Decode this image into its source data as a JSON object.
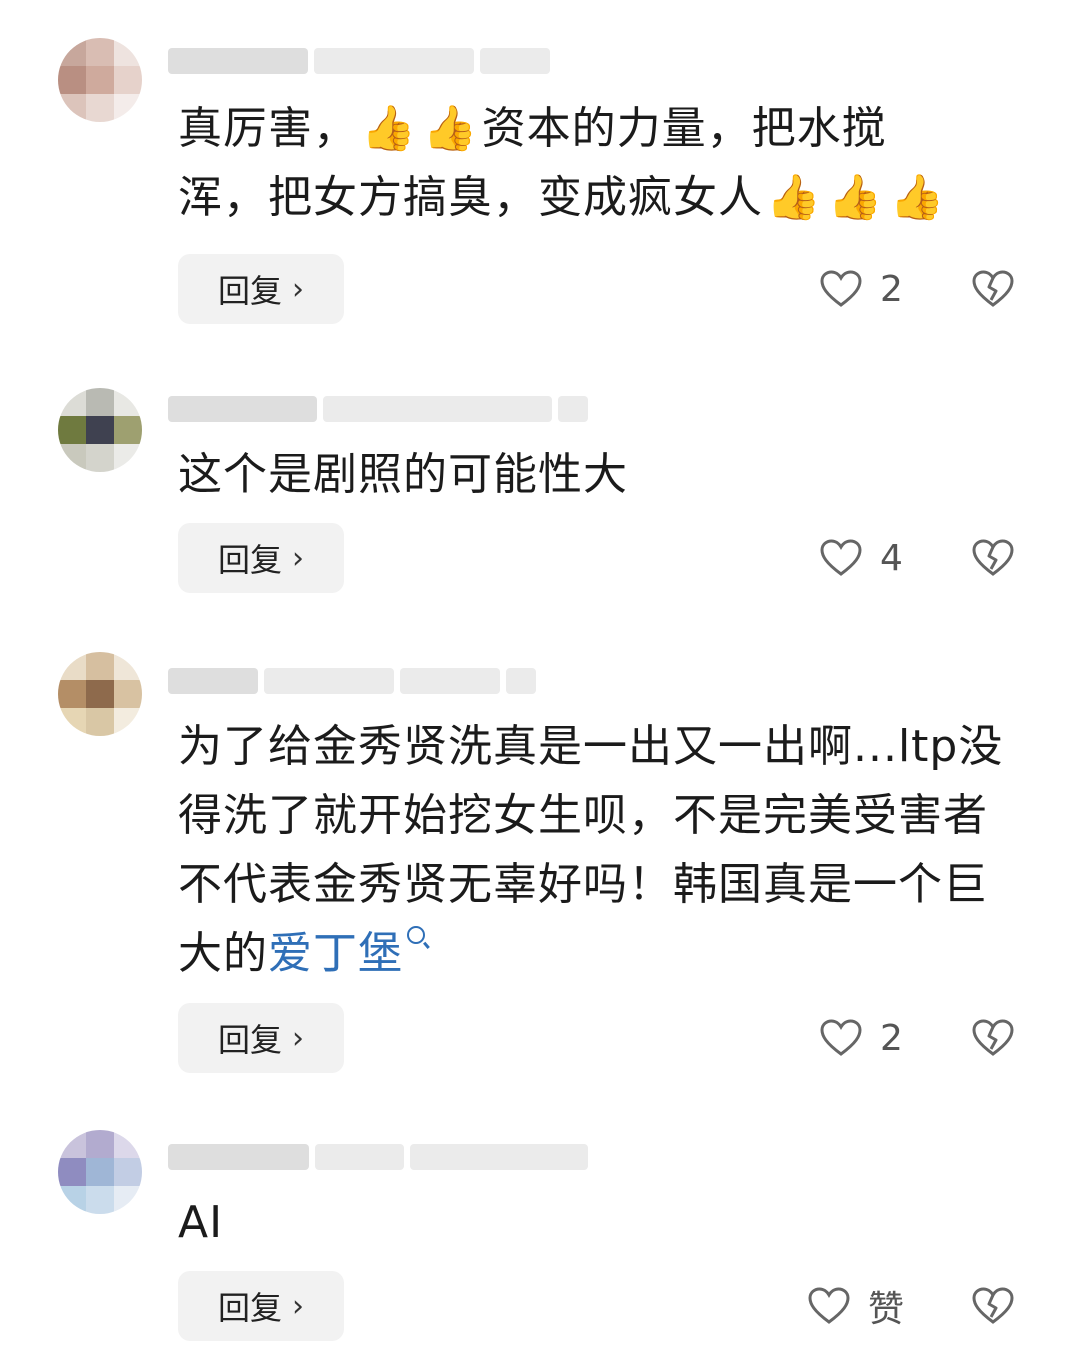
{
  "comments": [
    {
      "segments_line1_a": "真厉害，",
      "segments_line1_b": "资本的力量，把水搅",
      "segments_line2": "浑，把女方搞臭，变成疯女人",
      "reply_label": "回复",
      "like_count": "2"
    },
    {
      "text": "这个是剧照的可能性大",
      "reply_label": "回复",
      "like_count": "4"
    },
    {
      "text_main": "为了给金秀贤洗真是一出又一出啊...ltp没得洗了就开始挖女生呗，不是完美受害者不代表金秀贤无辜好吗！韩国真是一个巨大的",
      "link_text": "爱丁堡",
      "reply_label": "回复",
      "like_count": "2"
    },
    {
      "text": "AI",
      "reply_label": "回复",
      "like_count": "赞"
    }
  ],
  "icons": {
    "like": "heart-outline-icon",
    "dislike": "broken-heart-icon",
    "emoji": "thumbs-up-emoji",
    "search": "search-icon",
    "reply_arrow": "chevron-right-icon"
  },
  "colors": {
    "link": "#2f6fb7",
    "reply_bg": "#f2f2f2",
    "icon_stroke": "#666666"
  }
}
